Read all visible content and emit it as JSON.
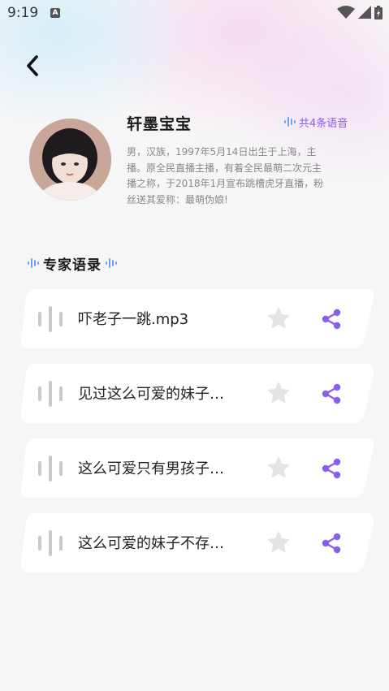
{
  "status_bar": {
    "time": "9:19",
    "notification_icon": "a-icon",
    "icons": [
      "wifi-icon",
      "signal-icon",
      "battery-icon"
    ]
  },
  "header": {
    "back_icon": "chevron-left-icon"
  },
  "profile": {
    "name": "轩墨宝宝",
    "voice_count": "共4条语音",
    "bio": "男，汉族，1997年5月14日出生于上海，主播。原全民直播主播，有着全民最萌二次元主播之称，于2018年1月宣布跳槽虎牙直播，粉丝送其爱称：最萌伪娘!"
  },
  "section": {
    "title": "专家语录"
  },
  "voices": [
    {
      "title": "吓老子一跳.mp3"
    },
    {
      "title": "见过这么可爱的妹子…"
    },
    {
      "title": "这么可爱只有男孩子…"
    },
    {
      "title": "这么可爱的妹子不存…"
    }
  ],
  "colors": {
    "accent": "#8a5cf0",
    "wave_blue": "#6fa3f5",
    "bar_gray": "#c9c9cc",
    "star_gray": "#e4e4e6"
  }
}
